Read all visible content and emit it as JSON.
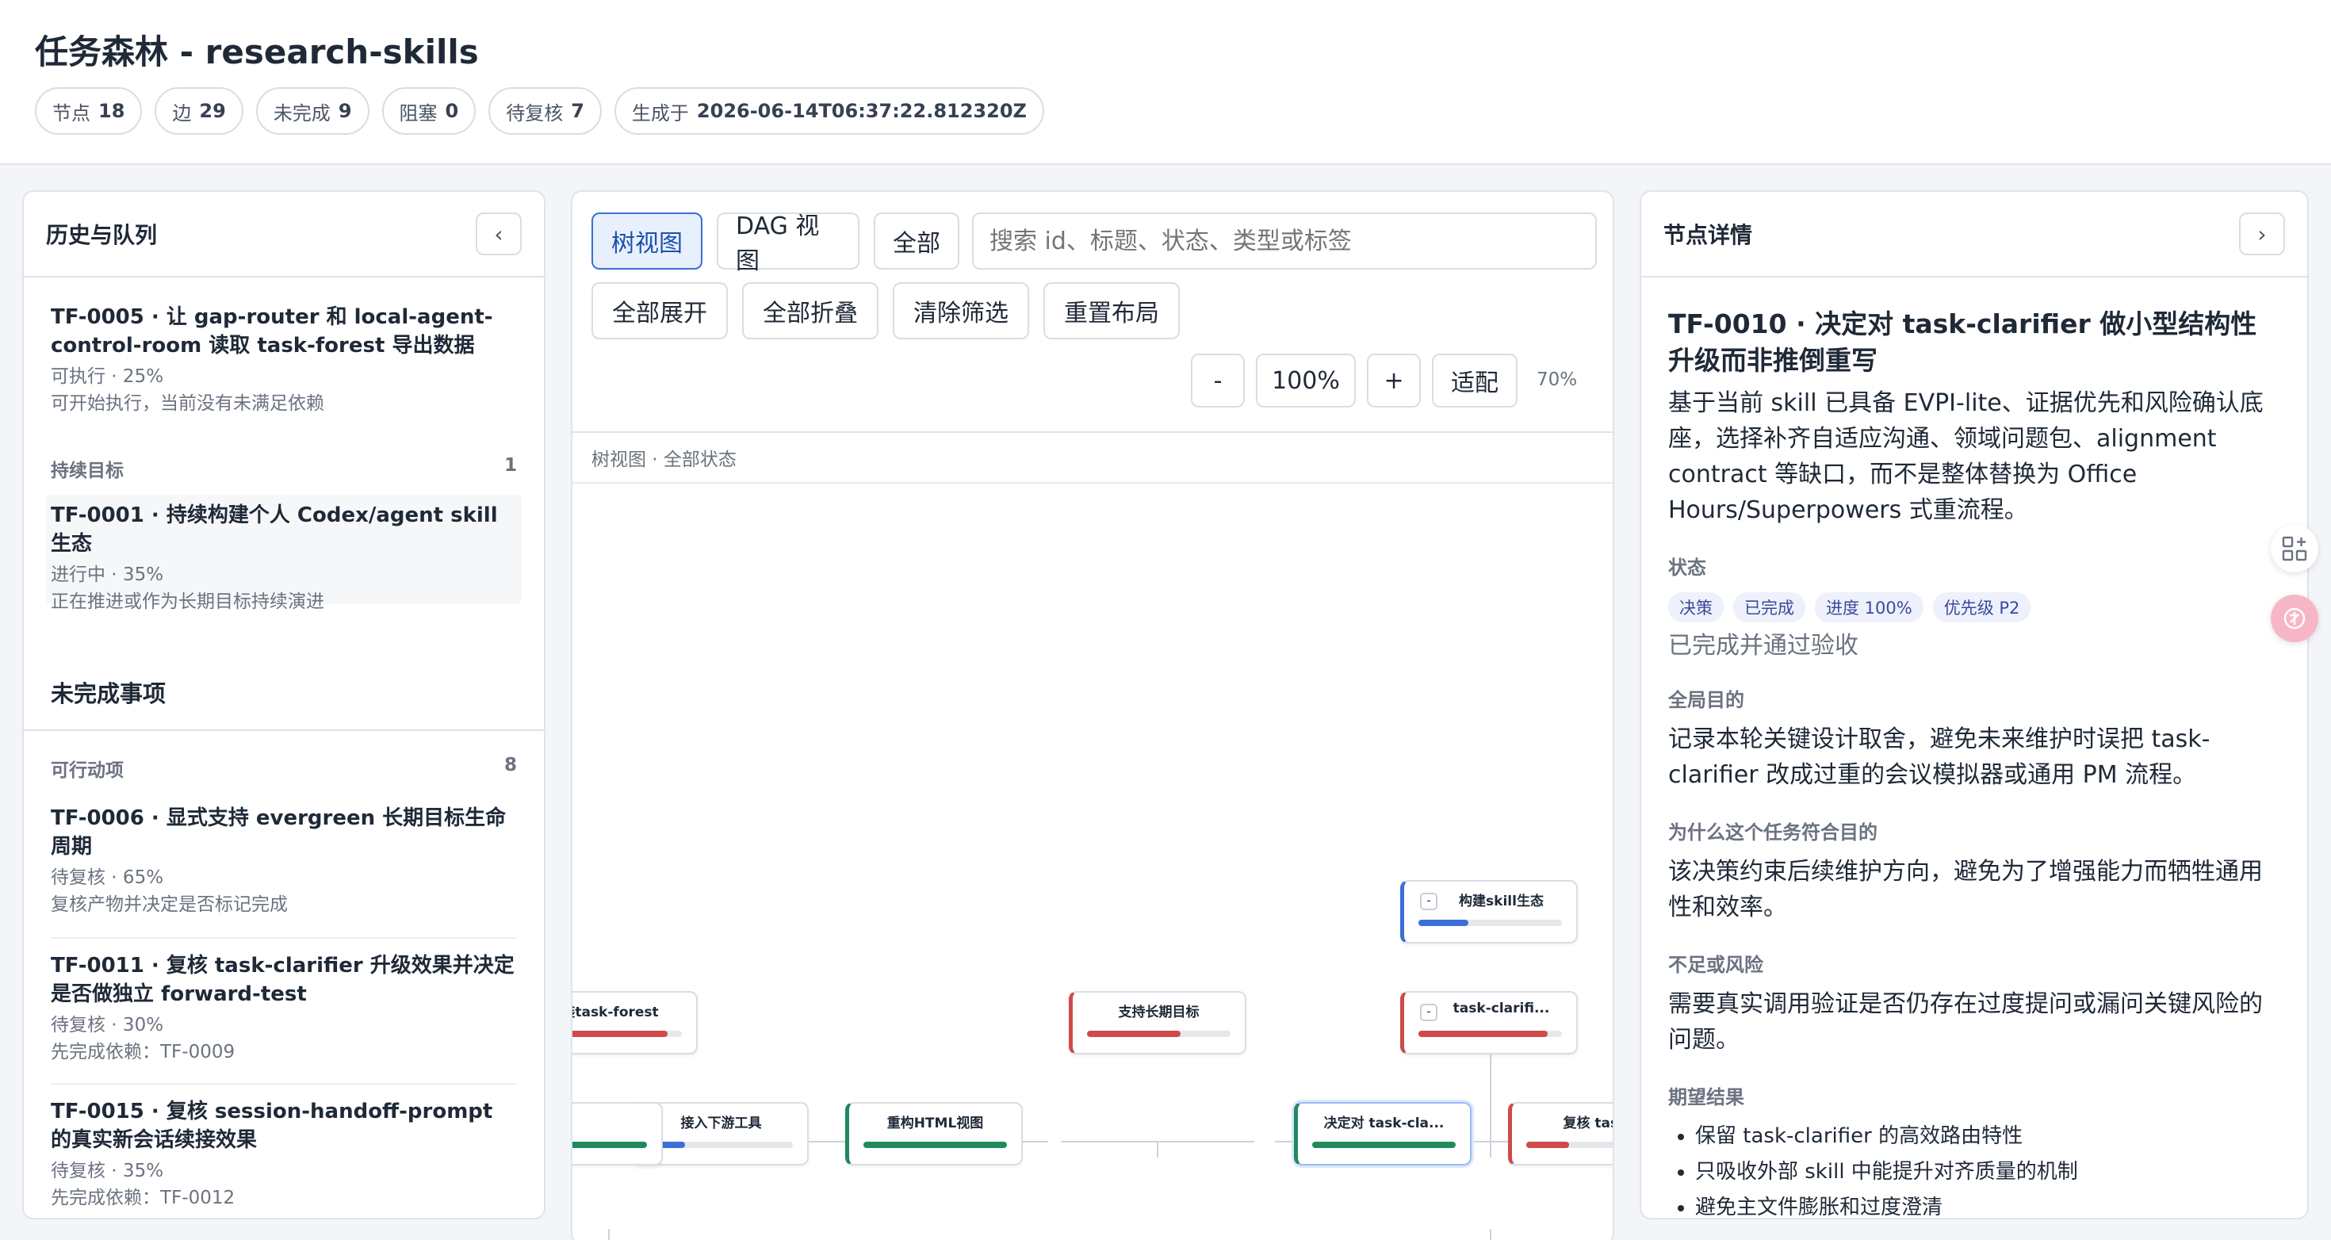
{
  "header": {
    "title": "任务森林 - research-skills",
    "stats": [
      {
        "label": "节点",
        "value": "18"
      },
      {
        "label": "边",
        "value": "29"
      },
      {
        "label": "未完成",
        "value": "9"
      },
      {
        "label": "阻塞",
        "value": "0"
      },
      {
        "label": "待复核",
        "value": "7"
      },
      {
        "label": "生成于",
        "value": "2026-06-14T06:37:22.812320Z"
      }
    ]
  },
  "left": {
    "title": "历史与队列",
    "collapse_label": "‹",
    "top_item": {
      "title": "TF-0005 · 让 gap-router 和 local-agent-control-room 读取 task-forest 导出数据",
      "meta": "可执行 · 25%",
      "note": "可开始执行，当前没有未满足依赖"
    },
    "goal_section": {
      "label": "持续目标",
      "count": "1"
    },
    "goal_item": {
      "title": "TF-0001 · 持续构建个人 Codex/agent skill 生态",
      "meta": "进行中 · 35%",
      "note": "正在推进或作为长期目标持续演进"
    },
    "pending_title": "未完成事项",
    "action_section": {
      "label": "可行动项",
      "count": "8"
    },
    "items": [
      {
        "title": "TF-0006 · 显式支持 evergreen 长期目标生命周期",
        "meta": "待复核 · 65%",
        "note": "复核产物并决定是否标记完成"
      },
      {
        "title": "TF-0011 · 复核 task-clarifier 升级效果并决定是否做独立 forward-test",
        "meta": "待复核 · 30%",
        "note": "先完成依赖：TF-0009"
      },
      {
        "title": "TF-0015 · 复核 session-handoff-prompt 的真实新会话续接效果",
        "meta": "待复核 · 35%",
        "note": "先完成依赖：TF-0012"
      }
    ]
  },
  "center": {
    "tree_view": "树视图",
    "dag_view": "DAG 视图",
    "all": "全部",
    "search_placeholder": "搜索 id、标题、状态、类型或标签",
    "expand_all": "全部展开",
    "collapse_all": "全部折叠",
    "clear_filter": "清除筛选",
    "reset_layout": "重置布局",
    "zoom_out": "-",
    "zoom": "100%",
    "zoom_in": "+",
    "fit": "适配",
    "zoom_hint": "70%",
    "view_caption": "树视图 · 全部状态",
    "nodes": [
      {
        "id": "root",
        "label": "构建skill生态",
        "progress": 0.35,
        "color": "#3a6fd8",
        "toggle": "-"
      },
      {
        "id": "forest",
        "label": "装task-forest",
        "progress": 0.9,
        "color": "#cf4a4a",
        "toggle": ""
      },
      {
        "id": "evergreen",
        "label": "支持长期目标",
        "progress": 0.65,
        "color": "#cf4a4a",
        "toggle": ""
      },
      {
        "id": "clarifier",
        "label": "task-clarifi...",
        "progress": 0.9,
        "color": "#cf4a4a",
        "toggle": "-"
      },
      {
        "id": "downstream",
        "label": "接入下游工具",
        "progress": 0.25,
        "color": "#3a6fd8",
        "toggle": ""
      },
      {
        "id": "html",
        "label": "重构HTML视图",
        "progress": 1.0,
        "color": "#1f8a5b",
        "toggle": ""
      },
      {
        "id": "decide",
        "label": "决定对 task-cla...",
        "progress": 1.0,
        "color": "#1f8a5b",
        "toggle": ""
      },
      {
        "id": "review",
        "label": "复核 task-",
        "progress": 0.3,
        "color": "#cf4a4a",
        "toggle": ""
      },
      {
        "id": "partial",
        "label": "",
        "progress": 1.0,
        "color": "#1f8a5b",
        "toggle": ""
      }
    ]
  },
  "right": {
    "title": "节点详情",
    "collapse_label": "›",
    "node_title": "TF-0010 · 决定对 task-clarifier 做小型结构性升级而非推倒重写",
    "description": "基于当前 skill 已具备 EVPI-lite、证据优先和风险确认底座，选择补齐自适应沟通、领域问题包、alignment contract 等缺口，而不是整体替换为 Office Hours/Superpowers 式重流程。",
    "status_label": "状态",
    "tags": [
      "决策",
      "已完成",
      "进度 100%",
      "优先级 P2"
    ],
    "status_text": "已完成并通过验收",
    "goal_label": "全局目的",
    "goal_text": "记录本轮关键设计取舍，避免未来维护时误把 task-clarifier 改成过重的会议模拟器或通用 PM 流程。",
    "why_label": "为什么这个任务符合目的",
    "why_text": "该决策约束后续维护方向，避免为了增强能力而牺牲通用性和效率。",
    "risk_label": "不足或风险",
    "risk_text": "需要真实调用验证是否仍存在过度提问或漏问关键风险的问题。",
    "expect_label": "期望结果",
    "expect_items": [
      "保留 task-clarifier 的高效路由特性",
      "只吸收外部 skill 中能提升对齐质量的机制",
      "避免主文件膨胀和过度澄清"
    ]
  }
}
